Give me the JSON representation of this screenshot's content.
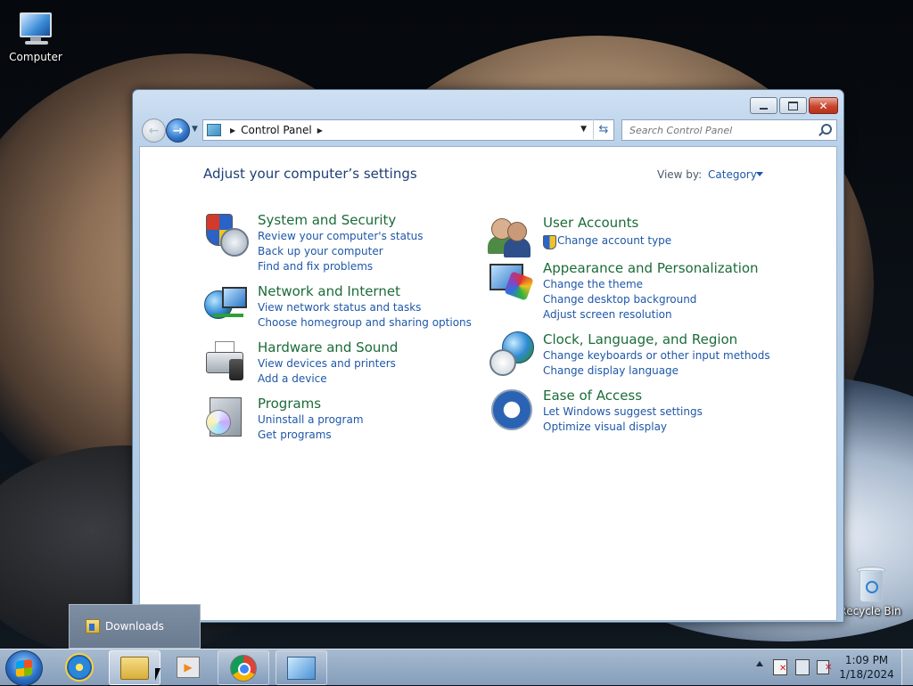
{
  "desktop": {
    "icons": [
      {
        "label": "Computer"
      },
      {
        "label": "Recycle Bin"
      }
    ]
  },
  "window": {
    "address": {
      "crumb": "Control Panel"
    },
    "search": {
      "placeholder": "Search Control Panel"
    },
    "heading": "Adjust your computer’s settings",
    "view_by": {
      "label": "View by:",
      "value": "Category"
    },
    "categories_left": [
      {
        "title": "System and Security",
        "links": [
          "Review your computer's status",
          "Back up your computer",
          "Find and fix problems"
        ]
      },
      {
        "title": "Network and Internet",
        "links": [
          "View network status and tasks",
          "Choose homegroup and sharing options"
        ]
      },
      {
        "title": "Hardware and Sound",
        "links": [
          "View devices and printers",
          "Add a device"
        ]
      },
      {
        "title": "Programs",
        "links": [
          "Uninstall a program",
          "Get programs"
        ]
      }
    ],
    "categories_right": [
      {
        "title": "User Accounts",
        "links": [
          "Change account type"
        ]
      },
      {
        "title": "Appearance and Personalization",
        "links": [
          "Change the theme",
          "Change desktop background",
          "Adjust screen resolution"
        ]
      },
      {
        "title": "Clock, Language, and Region",
        "links": [
          "Change keyboards or other input methods",
          "Change display language"
        ]
      },
      {
        "title": "Ease of Access",
        "links": [
          "Let Windows suggest settings",
          "Optimize visual display"
        ]
      }
    ]
  },
  "jumplist": {
    "item": "Downloads"
  },
  "taskbar": {
    "clock": {
      "time": "1:09 PM",
      "date": "1/18/2024"
    }
  }
}
